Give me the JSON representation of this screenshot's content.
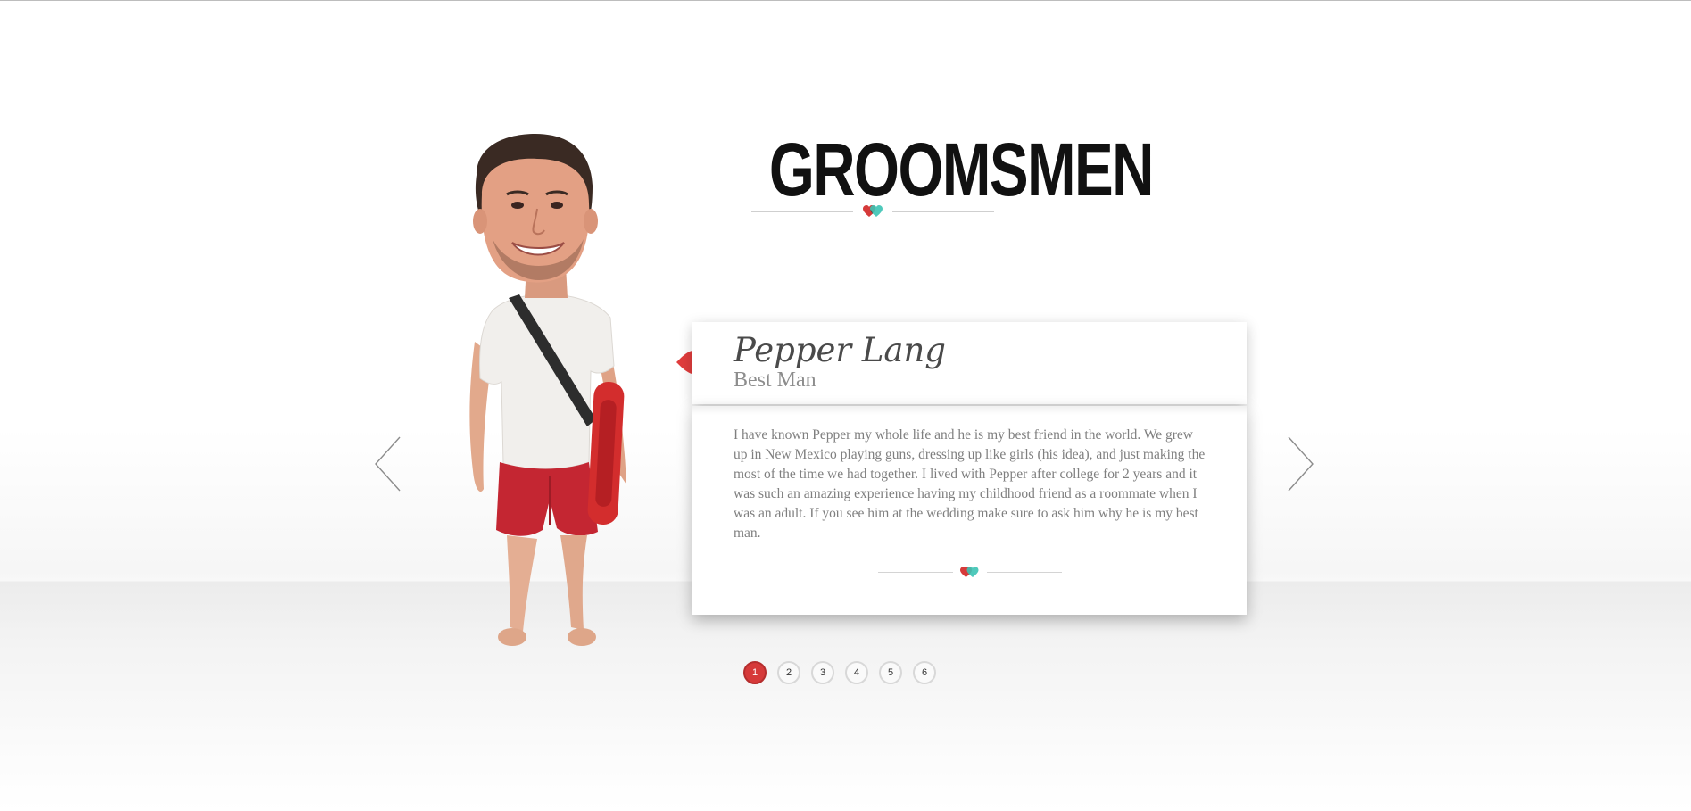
{
  "header": {
    "title": "GROOMSMEN"
  },
  "icons": {
    "title_divider": "hearts-icon",
    "bio_divider": "hearts-icon",
    "tag": "red-tag-pin-icon",
    "prev": "chevron-left-icon",
    "next": "chevron-right-icon"
  },
  "colors": {
    "accent_red": "#d63a3a",
    "accent_teal": "#3cc3b4",
    "heart_dark": "#3a3a3a"
  },
  "profile": {
    "name": "Pepper Lang",
    "role": "Best Man",
    "bio": "I have known Pepper my whole life and he is my best friend in the world. We grew up in New Mexico playing guns, dressing up like girls (his idea), and just making the most of the time we had together. I lived with Pepper after college for 2 years and it was such an amazing experience having my childhood friend as a roommate when I was an adult. If you see him at the wedding make sure to ask him why he is my best man.",
    "photo_alt": "groomsman photo"
  },
  "pagination": {
    "pages": [
      "1",
      "2",
      "3",
      "4",
      "5",
      "6"
    ],
    "current": "1"
  }
}
